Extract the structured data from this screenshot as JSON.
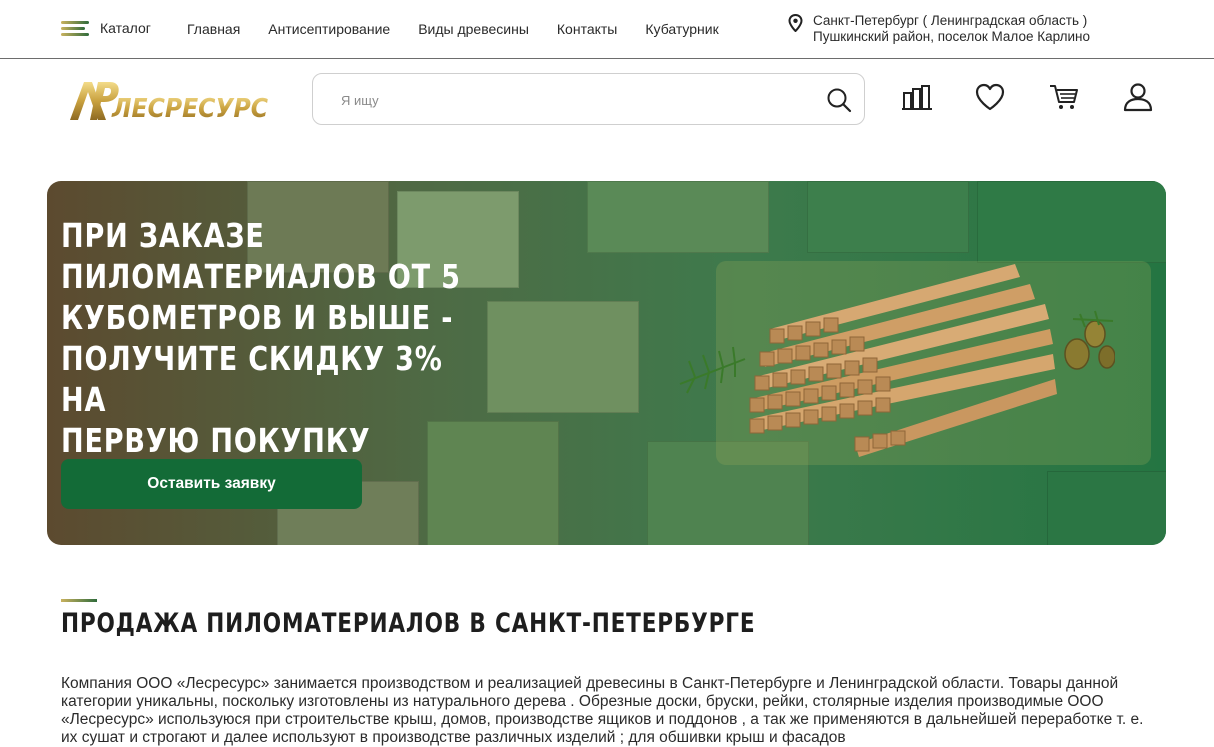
{
  "topbar": {
    "catalog_label": "Каталог",
    "nav": [
      "Главная",
      "Антисептирование",
      "Виды древесины",
      "Контакты",
      "Кубатурник"
    ],
    "location_line1": "Санкт-Петербург ( Ленинградская область )",
    "location_line2": "Пушкинский район, поселок Малое Карлино"
  },
  "header": {
    "logo_text": "ЛЕСРЕСУРС",
    "logo_mark": "AP",
    "search_placeholder": "Я ищу",
    "icons": [
      "compare-icon",
      "heart-icon",
      "cart-icon",
      "user-icon"
    ]
  },
  "banner": {
    "title_lines": [
      "ПРИ ЗАКАЗЕ",
      "ПИЛОМАТЕРИАЛОВ ОТ 5",
      "КУБОМЕТРОВ И ВЫШЕ -",
      "ПОЛУЧИТЕ СКИДКУ 3% НА",
      "ПЕРВУЮ ПОКУПКУ"
    ],
    "button_label": "Оставить заявку"
  },
  "section": {
    "title": "ПРОДАЖА ПИЛОМАТЕРИАЛОВ В САНКТ-ПЕТЕРБУРГЕ",
    "text": "Компания ООО «Лесресурс» занимается производством и реализацией древесины в Санкт-Петербурге и Ленинградской области. Товары данной категории уникальны, поскольку изготовлены из натурального дерева . Обрезные доски, бруски, рейки, столярные изделия производимые ООО «Лесресурс» используюся при строительстве крыш, домов, производстве ящиков и поддонов , а так же применяются в дальнейшей переработке т. е. их сушат и строгают и далее используют в производстве различных изделий ; для обшивки крыш и фасадов"
  },
  "colors": {
    "accent_green": "#136b37",
    "logo_gold": "#c9a94a"
  }
}
